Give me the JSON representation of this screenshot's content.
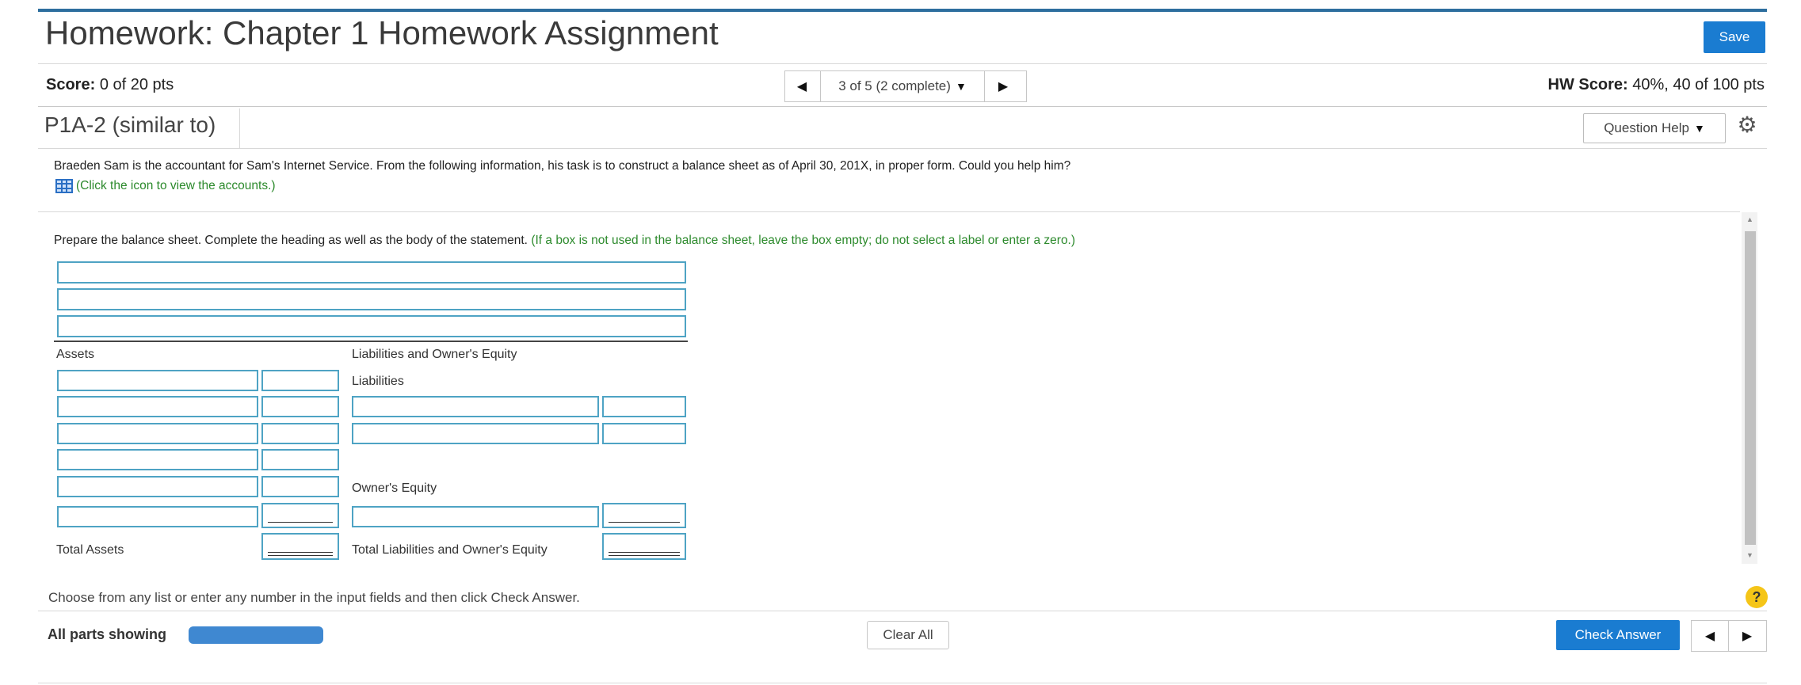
{
  "header": {
    "title": "Homework: Chapter 1 Homework Assignment",
    "save_label": "Save"
  },
  "score": {
    "label": "Score:",
    "value": "0 of 20 pts",
    "hw_label": "HW Score:",
    "hw_value": "40%, 40 of 100 pts"
  },
  "nav": {
    "position": "3 of 5 (2 complete)"
  },
  "question": {
    "title": "P1A-2 (similar to)",
    "help_label": "Question Help",
    "intro": "Braeden Sam is the accountant for Sam's Internet Service. From the following information, his task is to construct a balance sheet as of April 30, 201X, in proper form. Could you help him?",
    "icon_link": "(Click the icon to view the accounts.)",
    "instruction": "Prepare the balance sheet. Complete the heading as well as the body of the statement.",
    "instruction_note": "(If a box is not used in the balance sheet, leave the box empty; do not select a label or enter a zero.)"
  },
  "balance_sheet": {
    "assets_label": "Assets",
    "liab_equity_label": "Liabilities and Owner's Equity",
    "liabilities_label": "Liabilities",
    "owners_equity_label": "Owner's Equity",
    "total_assets_label": "Total Assets",
    "total_liab_equity_label": "Total Liabilities and Owner's Equity"
  },
  "footer": {
    "choose_text": "Choose from any list or enter any number in the input fields and then click Check Answer.",
    "all_parts": "All parts showing",
    "clear_all": "Clear All",
    "check_answer": "Check Answer",
    "help_glyph": "?"
  },
  "colors": {
    "accent": "#1a7cd1",
    "input_border": "#4ea3c4",
    "link_green": "#2c8a2c"
  }
}
